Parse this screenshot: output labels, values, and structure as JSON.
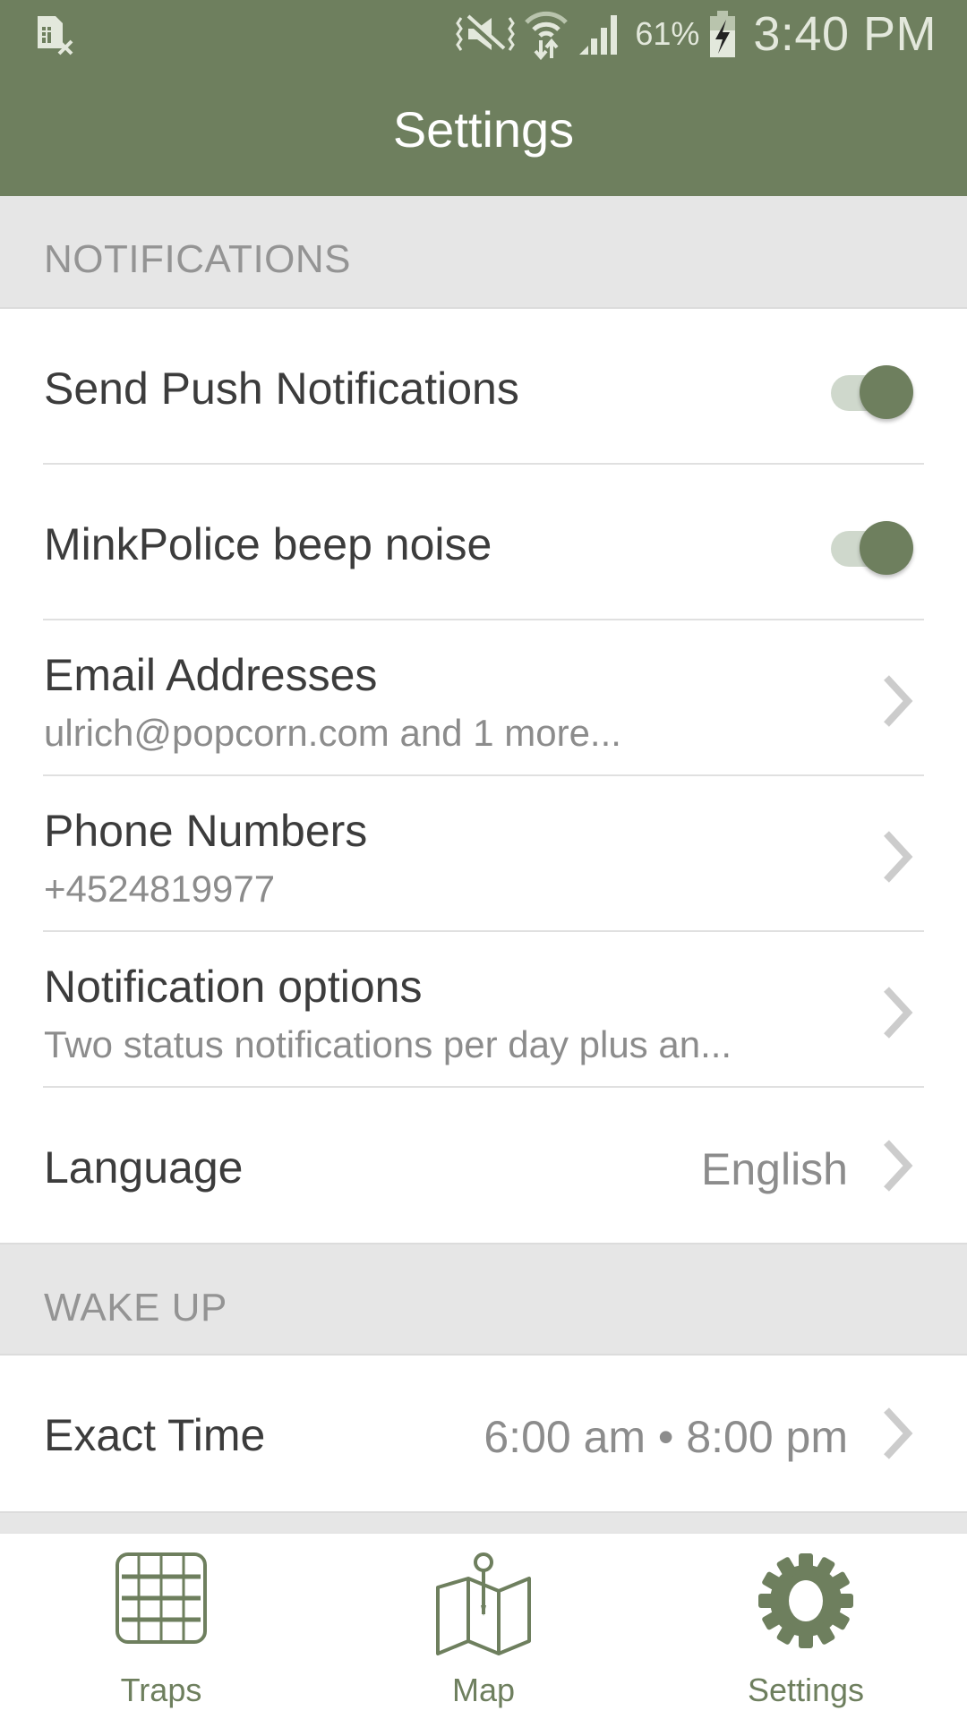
{
  "status_bar": {
    "left_icon": "sim-card-missing-icon",
    "icons": [
      "vibrate-mute-icon",
      "wifi-data-icon",
      "cellular-signal-icon",
      "battery-charging-icon"
    ],
    "battery_percent": "61%",
    "time": "3:40 PM"
  },
  "header": {
    "title": "Settings"
  },
  "colors": {
    "accent": "#6e7f5e",
    "section_bg": "#e6e6e6",
    "toggle_track": "#cfd8cc"
  },
  "sections": [
    {
      "label": "NOTIFICATIONS",
      "rows": [
        {
          "title": "Send Push Notifications",
          "type": "toggle",
          "on": true
        },
        {
          "title": "MinkPolice beep noise",
          "type": "toggle",
          "on": true
        },
        {
          "title": "Email Addresses",
          "subtitle": "ulrich@popcorn.com  and 1 more...",
          "type": "nav"
        },
        {
          "title": "Phone Numbers",
          "subtitle": "+4524819977",
          "type": "nav"
        },
        {
          "title": "Notification options",
          "subtitle": "Two status notifications per day plus an...",
          "type": "nav"
        },
        {
          "title": "Language",
          "value": "English",
          "type": "nav"
        }
      ]
    },
    {
      "label": "WAKE UP",
      "rows": [
        {
          "title": "Exact Time",
          "value": "6:00 am • 8:00 pm",
          "type": "nav"
        }
      ]
    }
  ],
  "tabs": [
    {
      "label": "Traps",
      "icon": "traps-grid-icon"
    },
    {
      "label": "Map",
      "icon": "map-pin-icon"
    },
    {
      "label": "Settings",
      "icon": "gear-icon",
      "active": true
    }
  ]
}
